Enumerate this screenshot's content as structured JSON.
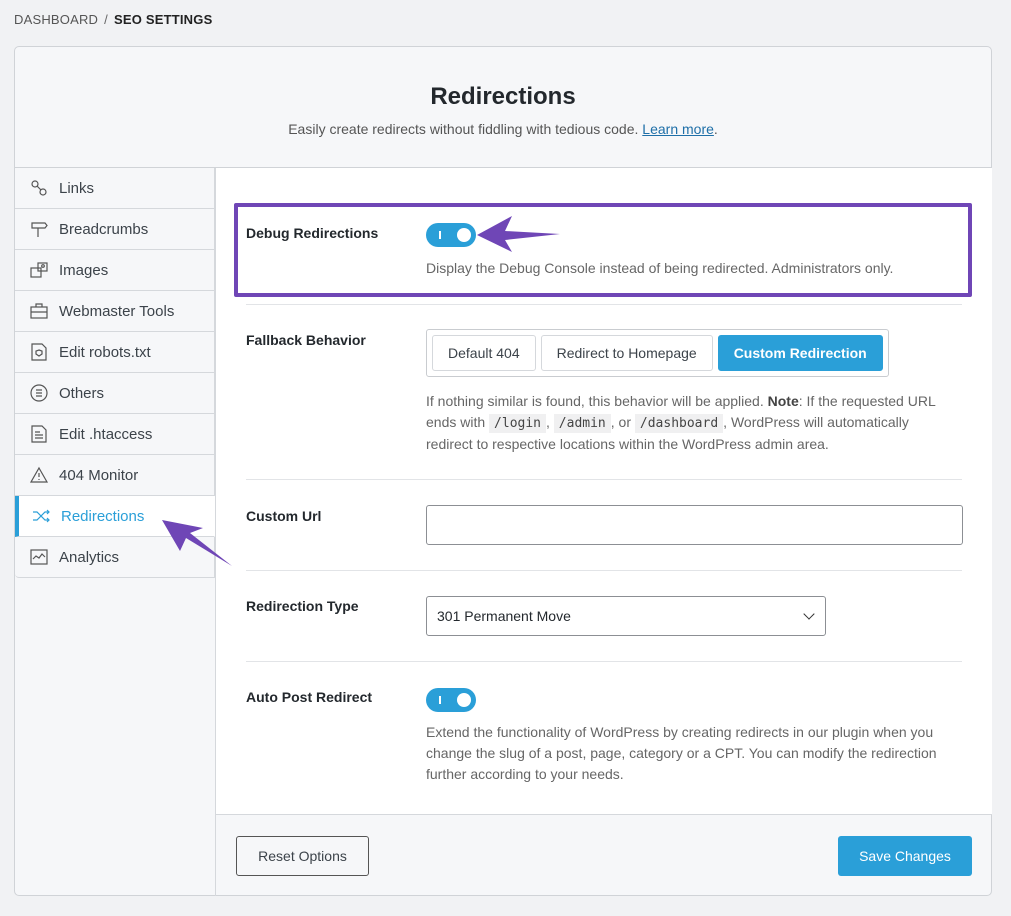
{
  "breadcrumb": {
    "root": "DASHBOARD",
    "separator": "/",
    "current": "SEO SETTINGS"
  },
  "header": {
    "title": "Redirections",
    "subtitle": "Easily create redirects without fiddling with tedious code.",
    "link": "Learn more",
    "period": "."
  },
  "sidebar": {
    "items": [
      {
        "label": "Links",
        "icon": "link-icon"
      },
      {
        "label": "Breadcrumbs",
        "icon": "signpost-icon"
      },
      {
        "label": "Images",
        "icon": "images-icon"
      },
      {
        "label": "Webmaster Tools",
        "icon": "toolbox-icon"
      },
      {
        "label": "Edit robots.txt",
        "icon": "shield-file-icon"
      },
      {
        "label": "Others",
        "icon": "list-circle-icon"
      },
      {
        "label": "Edit .htaccess",
        "icon": "file-icon"
      },
      {
        "label": "404 Monitor",
        "icon": "warning-icon"
      },
      {
        "label": "Redirections",
        "icon": "shuffle-icon",
        "active": true
      },
      {
        "label": "Analytics",
        "icon": "chart-icon"
      }
    ]
  },
  "settings": {
    "debug": {
      "label": "Debug Redirections",
      "enabled": true,
      "description": "Display the Debug Console instead of being redirected. Administrators only."
    },
    "fallback": {
      "label": "Fallback Behavior",
      "options": [
        "Default 404",
        "Redirect to Homepage",
        "Custom Redirection"
      ],
      "selected": "Custom Redirection",
      "desc_1": "If nothing similar is found, this behavior will be applied.",
      "note": "Note",
      "desc_2": ": If the requested URL ends with",
      "code1": "/login",
      "comma": ",",
      "code2": "/admin",
      "or": ", or",
      "code3": "/dashboard",
      "desc_3": ", WordPress will automatically redirect to respective locations within the WordPress admin area."
    },
    "custom_url": {
      "label": "Custom Url",
      "value": ""
    },
    "redirection_type": {
      "label": "Redirection Type",
      "value": "301 Permanent Move"
    },
    "auto_post": {
      "label": "Auto Post Redirect",
      "enabled": true,
      "description": "Extend the functionality of WordPress by creating redirects in our plugin when you change the slug of a post, page, category or a CPT. You can modify the redirection further according to your needs."
    }
  },
  "footer": {
    "reset": "Reset Options",
    "save": "Save Changes"
  },
  "colors": {
    "accent": "#2a9fd8",
    "annotation": "#6f46b6"
  }
}
